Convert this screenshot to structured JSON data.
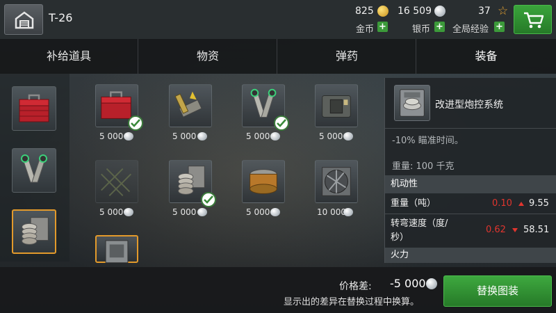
{
  "header": {
    "tank_name": "T-26",
    "gold_value": "825",
    "silver_value": "16 509",
    "global_xp_value": "37",
    "gold_label": "金币",
    "silver_label": "银币",
    "global_xp_label": "全局经验",
    "plus": "+"
  },
  "tabs": [
    {
      "label": "补给道具"
    },
    {
      "label": "物资"
    },
    {
      "label": "弹药"
    },
    {
      "label": "装备"
    }
  ],
  "grid": {
    "items": [
      {
        "icon": "toolbox-icon",
        "price": "5 000",
        "owned": true
      },
      {
        "icon": "rammer-icon",
        "price": "5 000",
        "owned": false
      },
      {
        "icon": "vertical-stabilizer-icon",
        "price": "5 000",
        "owned": true
      },
      {
        "icon": "ventilation-unit-icon",
        "price": "5 000",
        "owned": false
      },
      {
        "icon": "camouflage-net-icon",
        "price": "5 000",
        "owned": false
      },
      {
        "icon": "coil-spring-icon",
        "price": "5 000",
        "owned": true
      },
      {
        "icon": "filter-icon",
        "price": "5 000",
        "owned": false
      },
      {
        "icon": "fan-icon",
        "price": "10 000",
        "owned": false
      },
      {
        "icon": "fire-control-icon",
        "price": "",
        "owned": false
      }
    ]
  },
  "detail": {
    "title": "改进型炮控系统",
    "description": "-10% 瞄准时间。",
    "weight": "重量: 100 千克",
    "section_mobility": "机动性",
    "weight_label": "重量（吨）",
    "weight_new": "0.10",
    "weight_old": "9.55",
    "turn_label_1": "转弯速度（度/",
    "turn_label_2": "秒）",
    "turn_new": "0.62",
    "turn_old": "58.51",
    "section_firepower": "火力"
  },
  "footer": {
    "price_diff_label": "价格差:",
    "price_diff_value": "-5 000",
    "note": "显示出的差异在替换过程中换算。",
    "replace_button": "替换图装"
  },
  "colors": {
    "accent_green": "#3ea83f",
    "selected_orange": "#e39a2b",
    "negative_red": "#e0352e"
  }
}
